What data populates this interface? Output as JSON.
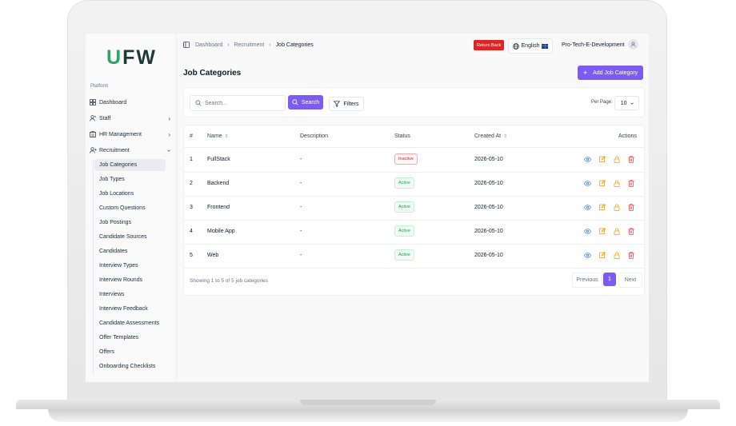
{
  "brand": {
    "u": "U",
    "fw": "FW"
  },
  "sidebar": {
    "section_label": "Platform",
    "items": [
      {
        "label": "Dashboard"
      },
      {
        "label": "Staff"
      },
      {
        "label": "HR Management"
      },
      {
        "label": "Recruitment"
      }
    ],
    "recruitment_sub": [
      "Job Categories",
      "Job Types",
      "Job Locations",
      "Custom Questions",
      "Job Postings",
      "Candidate Sources",
      "Candidates",
      "Interview Types",
      "Interview Rounds",
      "Interviews",
      "Interview Feedback",
      "Candidate Assessments",
      "Offer Templates",
      "Offers",
      "Onboarding Checklists"
    ]
  },
  "breadcrumb": [
    "Dashboard",
    "Recruitment",
    "Job Categories"
  ],
  "topbar": {
    "return_label": "Return Back",
    "language": "English",
    "org": "Pro-Tech-E-Development"
  },
  "page": {
    "title": "Job Categories",
    "add_label": "Add Job Category"
  },
  "search": {
    "placeholder": "Search...",
    "button": "Search",
    "filters": "Filters",
    "per_page_label": "Per Page:",
    "per_page": "10"
  },
  "table": {
    "headers": {
      "num": "#",
      "name": "Name",
      "description": "Description",
      "status": "Status",
      "created": "Created At",
      "actions": "Actions"
    },
    "rows": [
      {
        "num": "1",
        "name": "FullStack",
        "description": "-",
        "status": "Inactive",
        "created": "2026-05-10"
      },
      {
        "num": "2",
        "name": "Backend",
        "description": "-",
        "status": "Active",
        "created": "2026-05-10"
      },
      {
        "num": "3",
        "name": "Frontend",
        "description": "-",
        "status": "Active",
        "created": "2026-05-10"
      },
      {
        "num": "4",
        "name": "Mobile App",
        "description": "-",
        "status": "Active",
        "created": "2026-05-10"
      },
      {
        "num": "5",
        "name": "Web",
        "description": "-",
        "status": "Active",
        "created": "2026-05-10"
      }
    ]
  },
  "pagination": {
    "showing": "Showing 1 to 5 of 5 job categories",
    "prev": "Previous",
    "current": "1",
    "next": "Next"
  },
  "colors": {
    "accent": "#7c5cf0",
    "brand_green": "#2aa563",
    "danger": "#dc2626",
    "success": "#16a34a",
    "view": "#3b82f6",
    "edit": "#f59e0b",
    "lock": "#f59e0b",
    "delete": "#ef4444"
  }
}
